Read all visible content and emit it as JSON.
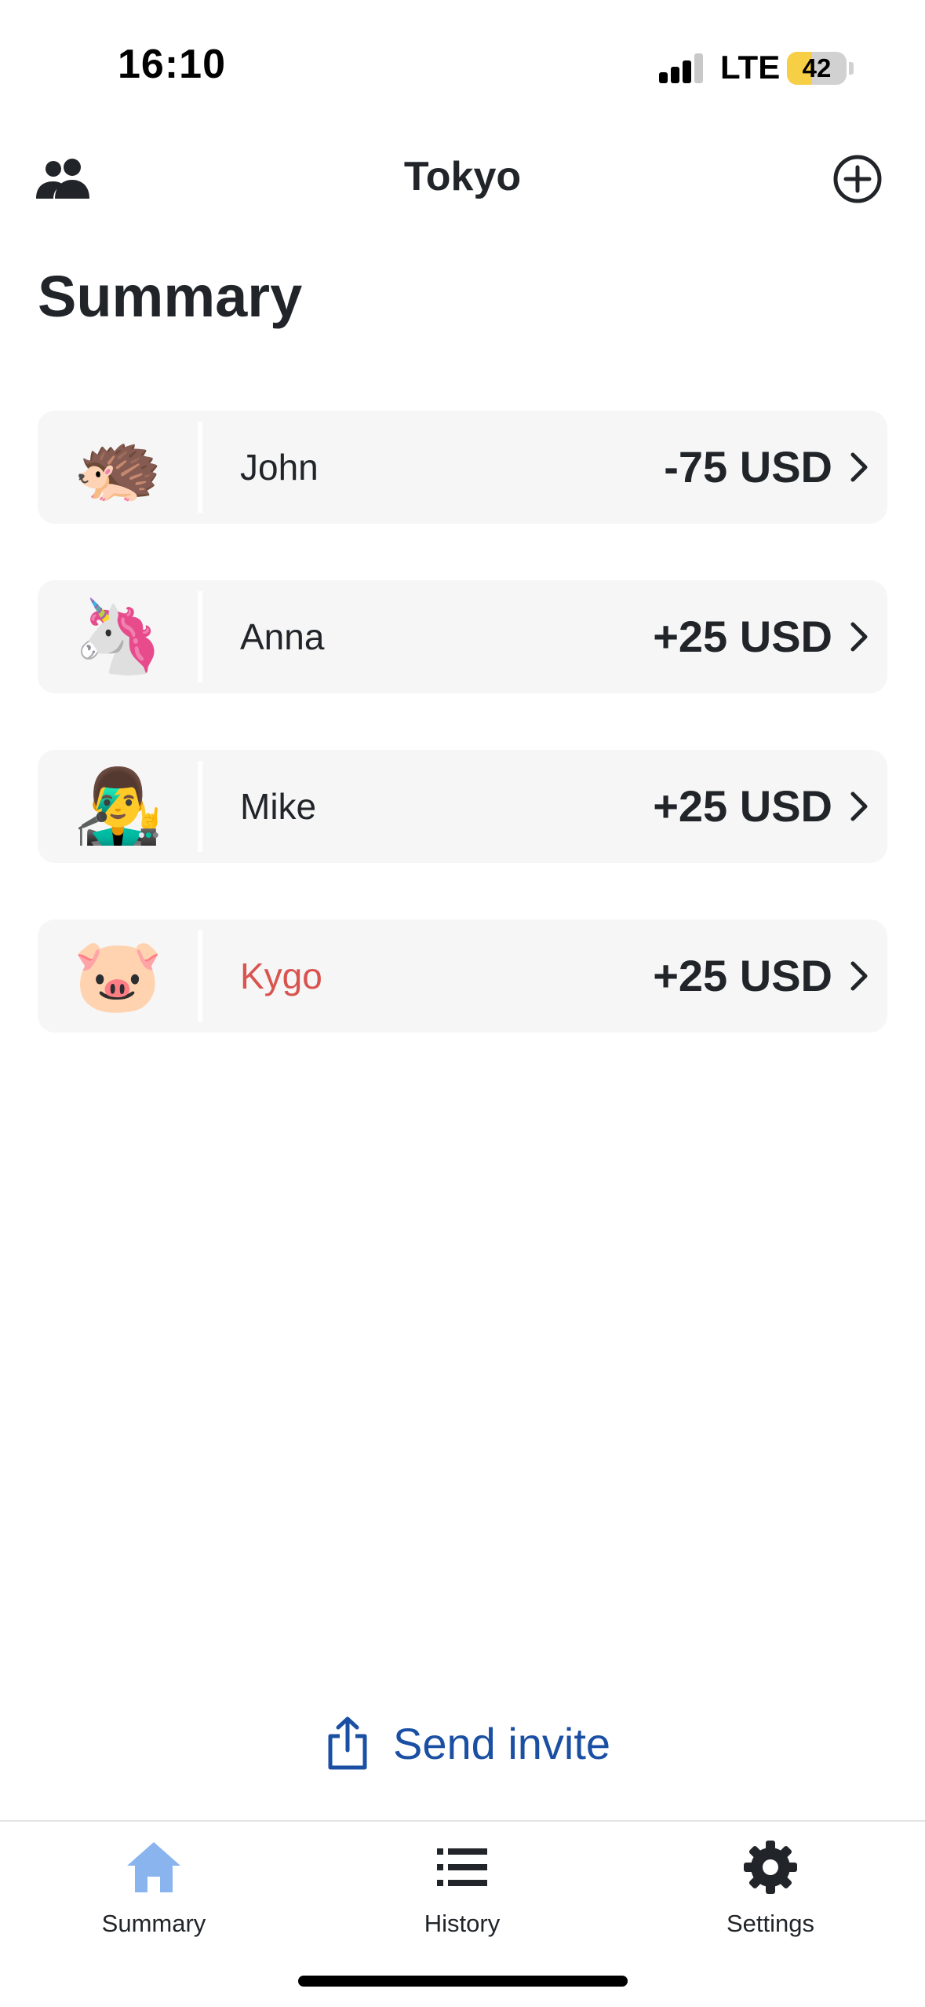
{
  "status_bar": {
    "time": "16:10",
    "network": "LTE",
    "battery": "42",
    "battery_level": 0.42
  },
  "navbar": {
    "title": "Tokyo",
    "left_icon": "group-icon",
    "right_icon": "add-circle-icon"
  },
  "page": {
    "title": "Summary"
  },
  "members": [
    {
      "avatar": "🦔",
      "name": "John",
      "amount": "-75 USD",
      "highlight": false
    },
    {
      "avatar": "🦄",
      "name": "Anna",
      "amount": "+25 USD",
      "highlight": false
    },
    {
      "avatar": "👨‍🎤",
      "name": "Mike",
      "amount": "+25 USD",
      "highlight": false
    },
    {
      "avatar": "🐷",
      "name": "Kygo",
      "amount": "+25 USD",
      "highlight": true
    }
  ],
  "invite": {
    "label": "Send invite",
    "icon": "share-icon"
  },
  "tabs": [
    {
      "label": "Summary",
      "icon": "home-icon",
      "active": true
    },
    {
      "label": "History",
      "icon": "list-icon",
      "active": false
    },
    {
      "label": "Settings",
      "icon": "gear-icon",
      "active": false
    }
  ],
  "colors": {
    "text": "#212529",
    "row_background": "#f6f6f6",
    "negative_name": "#d9534f",
    "link": "#1a4fa3",
    "active_tab_icon": "#8ab4ee",
    "battery_fill": "#f7cf45"
  }
}
